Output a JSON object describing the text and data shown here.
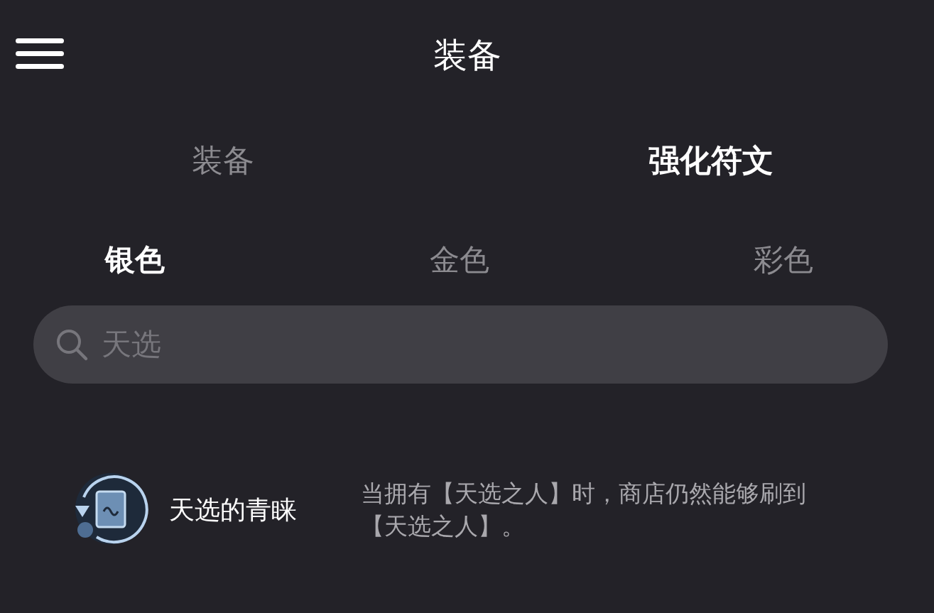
{
  "header": {
    "title": "装备"
  },
  "tabs": [
    {
      "label": "装备",
      "selected": false
    },
    {
      "label": "强化符文",
      "selected": true
    }
  ],
  "tiers": [
    {
      "label": "银色",
      "selected": true
    },
    {
      "label": "金色",
      "selected": false
    },
    {
      "label": "彩色",
      "selected": false
    }
  ],
  "search": {
    "value": "天选"
  },
  "results": [
    {
      "name": "天选的青睐",
      "description": "当拥有【天选之人】时，商店仍然能够刷到【天选之人】。"
    }
  ]
}
